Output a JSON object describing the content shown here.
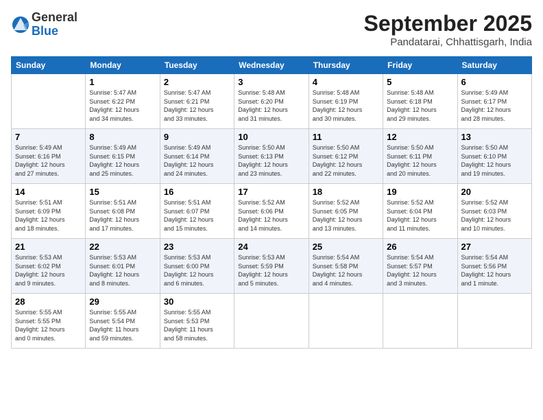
{
  "header": {
    "logo_general": "General",
    "logo_blue": "Blue",
    "month": "September 2025",
    "location": "Pandatarai, Chhattisgarh, India"
  },
  "days_of_week": [
    "Sunday",
    "Monday",
    "Tuesday",
    "Wednesday",
    "Thursday",
    "Friday",
    "Saturday"
  ],
  "weeks": [
    [
      {
        "num": "",
        "info": ""
      },
      {
        "num": "1",
        "info": "Sunrise: 5:47 AM\nSunset: 6:22 PM\nDaylight: 12 hours\nand 34 minutes."
      },
      {
        "num": "2",
        "info": "Sunrise: 5:47 AM\nSunset: 6:21 PM\nDaylight: 12 hours\nand 33 minutes."
      },
      {
        "num": "3",
        "info": "Sunrise: 5:48 AM\nSunset: 6:20 PM\nDaylight: 12 hours\nand 31 minutes."
      },
      {
        "num": "4",
        "info": "Sunrise: 5:48 AM\nSunset: 6:19 PM\nDaylight: 12 hours\nand 30 minutes."
      },
      {
        "num": "5",
        "info": "Sunrise: 5:48 AM\nSunset: 6:18 PM\nDaylight: 12 hours\nand 29 minutes."
      },
      {
        "num": "6",
        "info": "Sunrise: 5:49 AM\nSunset: 6:17 PM\nDaylight: 12 hours\nand 28 minutes."
      }
    ],
    [
      {
        "num": "7",
        "info": "Sunrise: 5:49 AM\nSunset: 6:16 PM\nDaylight: 12 hours\nand 27 minutes."
      },
      {
        "num": "8",
        "info": "Sunrise: 5:49 AM\nSunset: 6:15 PM\nDaylight: 12 hours\nand 25 minutes."
      },
      {
        "num": "9",
        "info": "Sunrise: 5:49 AM\nSunset: 6:14 PM\nDaylight: 12 hours\nand 24 minutes."
      },
      {
        "num": "10",
        "info": "Sunrise: 5:50 AM\nSunset: 6:13 PM\nDaylight: 12 hours\nand 23 minutes."
      },
      {
        "num": "11",
        "info": "Sunrise: 5:50 AM\nSunset: 6:12 PM\nDaylight: 12 hours\nand 22 minutes."
      },
      {
        "num": "12",
        "info": "Sunrise: 5:50 AM\nSunset: 6:11 PM\nDaylight: 12 hours\nand 20 minutes."
      },
      {
        "num": "13",
        "info": "Sunrise: 5:50 AM\nSunset: 6:10 PM\nDaylight: 12 hours\nand 19 minutes."
      }
    ],
    [
      {
        "num": "14",
        "info": "Sunrise: 5:51 AM\nSunset: 6:09 PM\nDaylight: 12 hours\nand 18 minutes."
      },
      {
        "num": "15",
        "info": "Sunrise: 5:51 AM\nSunset: 6:08 PM\nDaylight: 12 hours\nand 17 minutes."
      },
      {
        "num": "16",
        "info": "Sunrise: 5:51 AM\nSunset: 6:07 PM\nDaylight: 12 hours\nand 15 minutes."
      },
      {
        "num": "17",
        "info": "Sunrise: 5:52 AM\nSunset: 6:06 PM\nDaylight: 12 hours\nand 14 minutes."
      },
      {
        "num": "18",
        "info": "Sunrise: 5:52 AM\nSunset: 6:05 PM\nDaylight: 12 hours\nand 13 minutes."
      },
      {
        "num": "19",
        "info": "Sunrise: 5:52 AM\nSunset: 6:04 PM\nDaylight: 12 hours\nand 11 minutes."
      },
      {
        "num": "20",
        "info": "Sunrise: 5:52 AM\nSunset: 6:03 PM\nDaylight: 12 hours\nand 10 minutes."
      }
    ],
    [
      {
        "num": "21",
        "info": "Sunrise: 5:53 AM\nSunset: 6:02 PM\nDaylight: 12 hours\nand 9 minutes."
      },
      {
        "num": "22",
        "info": "Sunrise: 5:53 AM\nSunset: 6:01 PM\nDaylight: 12 hours\nand 8 minutes."
      },
      {
        "num": "23",
        "info": "Sunrise: 5:53 AM\nSunset: 6:00 PM\nDaylight: 12 hours\nand 6 minutes."
      },
      {
        "num": "24",
        "info": "Sunrise: 5:53 AM\nSunset: 5:59 PM\nDaylight: 12 hours\nand 5 minutes."
      },
      {
        "num": "25",
        "info": "Sunrise: 5:54 AM\nSunset: 5:58 PM\nDaylight: 12 hours\nand 4 minutes."
      },
      {
        "num": "26",
        "info": "Sunrise: 5:54 AM\nSunset: 5:57 PM\nDaylight: 12 hours\nand 3 minutes."
      },
      {
        "num": "27",
        "info": "Sunrise: 5:54 AM\nSunset: 5:56 PM\nDaylight: 12 hours\nand 1 minute."
      }
    ],
    [
      {
        "num": "28",
        "info": "Sunrise: 5:55 AM\nSunset: 5:55 PM\nDaylight: 12 hours\nand 0 minutes."
      },
      {
        "num": "29",
        "info": "Sunrise: 5:55 AM\nSunset: 5:54 PM\nDaylight: 11 hours\nand 59 minutes."
      },
      {
        "num": "30",
        "info": "Sunrise: 5:55 AM\nSunset: 5:53 PM\nDaylight: 11 hours\nand 58 minutes."
      },
      {
        "num": "",
        "info": ""
      },
      {
        "num": "",
        "info": ""
      },
      {
        "num": "",
        "info": ""
      },
      {
        "num": "",
        "info": ""
      }
    ]
  ]
}
